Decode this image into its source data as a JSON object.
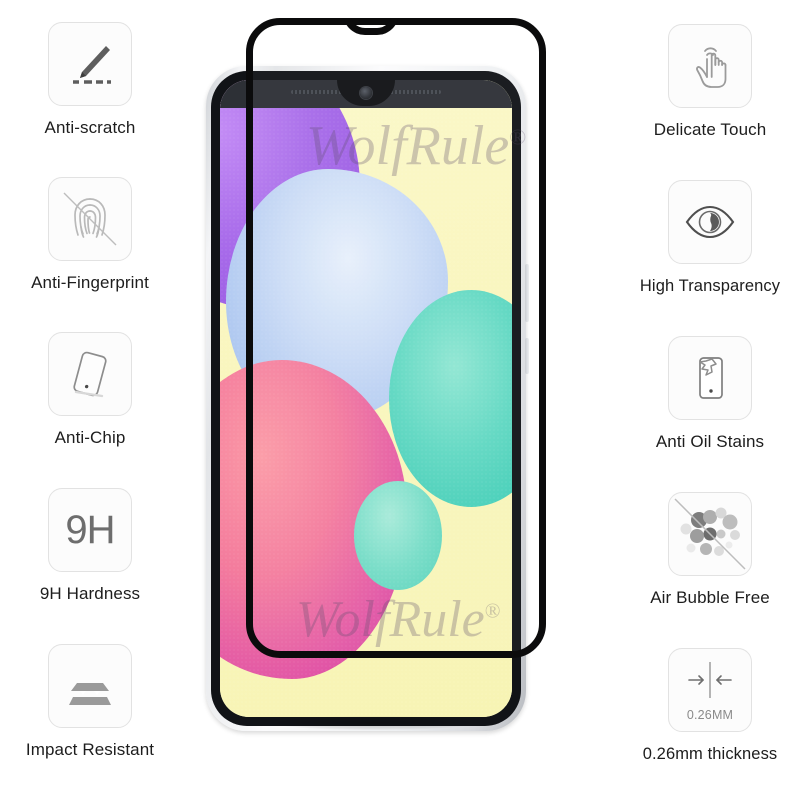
{
  "product": {
    "brand_watermark": "WolfRule",
    "brand_mark": "®"
  },
  "features_left": [
    {
      "label": "Anti-scratch",
      "icon": "knife-scratch-icon"
    },
    {
      "label": "Anti-Fingerprint",
      "icon": "fingerprint-crossed-icon"
    },
    {
      "label": "Anti-Chip",
      "icon": "tilted-phone-icon"
    },
    {
      "label": "9H Hardness",
      "icon": "hardness-9h-icon",
      "icon_text": "9H"
    },
    {
      "label": "Impact Resistant",
      "icon": "layered-shield-icon"
    }
  ],
  "features_right": [
    {
      "label": "Delicate Touch",
      "icon": "tap-hand-icon"
    },
    {
      "label": "High Transparency",
      "icon": "eye-icon"
    },
    {
      "label": "Anti Oil Stains",
      "icon": "phone-oil-smudge-icon"
    },
    {
      "label": "Air Bubble Free",
      "icon": "bubbles-crossed-icon"
    },
    {
      "label": "0.26mm thickness",
      "icon": "thickness-caliper-icon",
      "icon_text": "0.26MM"
    }
  ],
  "colors": {
    "icon_border": "#e2e2e2",
    "icon_glyph": "#8a8a8a",
    "label_text": "#1d1d1d",
    "glass_frame": "#0b0b0c",
    "watermark": "rgba(96,78,110,0.30)",
    "screen_purple": "#a86bea",
    "screen_blue": "#cbdcf6",
    "screen_pink": "#e257a6",
    "screen_teal": "#5fd8c2",
    "screen_yellow": "#f9f6bd"
  }
}
